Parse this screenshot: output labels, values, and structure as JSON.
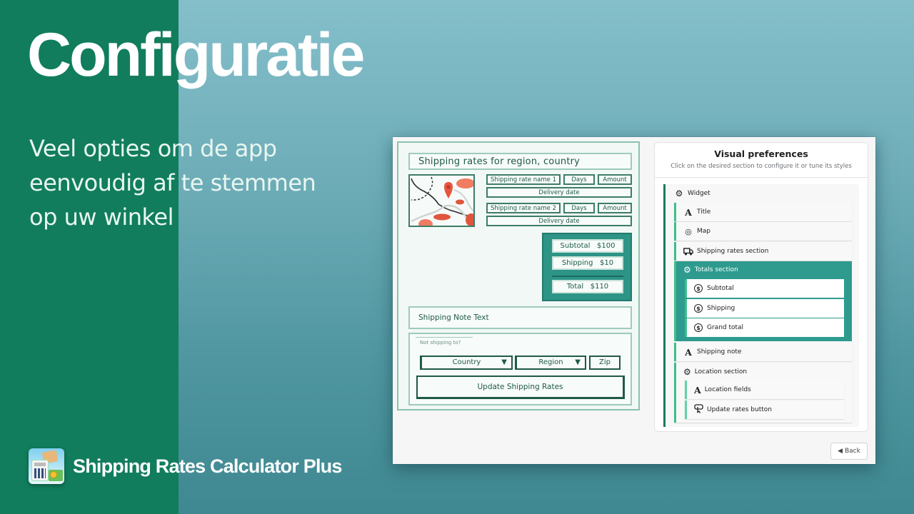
{
  "slide": {
    "title": "Configuratie",
    "subtitle_lines": [
      "Veel opties om de app",
      "eenvoudig af te stemmen",
      "op uw winkel"
    ],
    "brand_name": "Shipping Rates Calculator Plus",
    "brand_logo_icon": "calculator-parcel-money-icon",
    "colors": {
      "green_panel": "#117d5c",
      "teal_background": "#6eadb8",
      "accent_teal": "#2e9b8e",
      "tree_accent": "#3dbf8d"
    }
  },
  "widget_preview": {
    "title": "Shipping rates for region, country",
    "map_icon": "map-pin-icon",
    "rates": [
      {
        "name": "Shipping rate name 1",
        "days": "Days",
        "amount": "Amount",
        "delivery": "Delivery date"
      },
      {
        "name": "Shipping rate name 2",
        "days": "Days",
        "amount": "Amount",
        "delivery": "Delivery date"
      }
    ],
    "totals": [
      {
        "label": "Subtotal",
        "value": "$100"
      },
      {
        "label": "Shipping",
        "value": "$10"
      },
      {
        "label": "Total",
        "value": "$110"
      }
    ],
    "shipping_note": "Shipping Note Text",
    "location": {
      "label": "Not shipping to?",
      "country": "Country",
      "region": "Region",
      "zip": "Zip",
      "update_button": "Update Shipping Rates"
    }
  },
  "visual_preferences": {
    "title": "Visual preferences",
    "description": "Click on the desired section to configure it or tune its styles",
    "tree": {
      "root": {
        "label": "Widget",
        "icon": "gear-icon"
      },
      "items": [
        {
          "label": "Title",
          "icon": "typography-icon"
        },
        {
          "label": "Map",
          "icon": "location-pin-icon"
        },
        {
          "label": "Shipping rates section",
          "icon": "truck-icon"
        }
      ],
      "totals_section": {
        "label": "Totals section",
        "icon": "gear-icon",
        "selected": true,
        "children": [
          {
            "label": "Subtotal",
            "icon": "dollar-coin-icon"
          },
          {
            "label": "Shipping",
            "icon": "dollar-coin-icon"
          },
          {
            "label": "Grand total",
            "icon": "dollar-coin-icon"
          }
        ]
      },
      "shipping_note": {
        "label": "Shipping note",
        "icon": "typography-icon"
      },
      "location_section": {
        "label": "Location section",
        "icon": "gear-icon",
        "children": [
          {
            "label": "Location fields",
            "icon": "typography-icon"
          },
          {
            "label": "Update rates button",
            "icon": "button-click-icon"
          }
        ]
      }
    },
    "back_button": "◀ Back"
  }
}
